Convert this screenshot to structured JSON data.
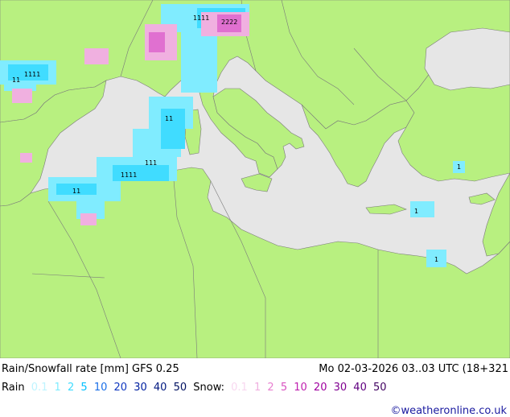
{
  "title": "Rain/Snowfall rate [mm] GFS 0.25",
  "datetime": "Mo 02-03-2026 03..03 UTC (18+321",
  "rain_legend": {
    "label": "Rain",
    "values": [
      "0.1",
      "1",
      "2",
      "5",
      "10",
      "20",
      "30",
      "40",
      "50"
    ],
    "colors": [
      "#bff4ff",
      "#80ecff",
      "#40dcff",
      "#00c0ff",
      "#1a6fe8",
      "#1038c0",
      "#0020a0",
      "#001880",
      "#001060"
    ]
  },
  "snow_legend": {
    "label": "Snow:",
    "values": [
      "0.1",
      "1",
      "2",
      "5",
      "10",
      "20",
      "30",
      "40",
      "50"
    ],
    "colors": [
      "#f8d8f0",
      "#f0b0e0",
      "#e880d0",
      "#d850c0",
      "#c020b0",
      "#a000a0",
      "#800090",
      "#600080",
      "#400060"
    ]
  },
  "credit": "©weatheronline.co.uk",
  "map_colors": {
    "sea": "#e6e6e6",
    "land": "#b8f080",
    "border": "#7a7a7a",
    "rain": "#80ecff",
    "rain_heavy": "#40dcff",
    "snow": "#f0b0e0",
    "snow_heavy": "#e070d0"
  }
}
